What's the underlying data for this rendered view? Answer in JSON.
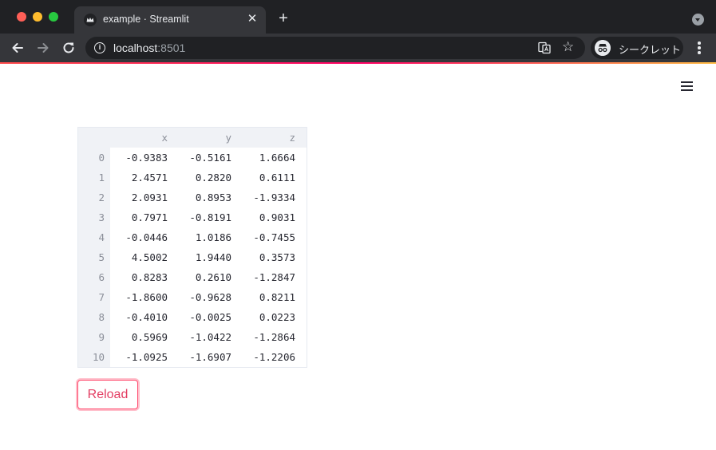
{
  "browser": {
    "tab_title": "example · Streamlit",
    "tab_close": "✕",
    "new_tab": "+",
    "url_host": "localhost",
    "url_port": ":8501",
    "incognito_label": "シークレット",
    "icons": [
      "back-arrow-icon",
      "forward-arrow-icon",
      "reload-icon",
      "info-icon",
      "translate-icon",
      "star-icon",
      "incognito-icon",
      "kebab-menu-icon",
      "tab-search-icon",
      "streamlit-crown-icon"
    ]
  },
  "app": {
    "menu_icon": "hamburger-icon",
    "accent_colors": [
      "#ff4b4b",
      "#ffbd45"
    ]
  },
  "dataframe": {
    "columns": [
      "x",
      "y",
      "z"
    ],
    "rows": [
      {
        "index": "0",
        "x": "-0.9383",
        "y": "-0.5161",
        "z": "1.6664"
      },
      {
        "index": "1",
        "x": "2.4571",
        "y": "0.2820",
        "z": "0.6111"
      },
      {
        "index": "2",
        "x": "2.0931",
        "y": "0.8953",
        "z": "-1.9334"
      },
      {
        "index": "3",
        "x": "0.7971",
        "y": "-0.8191",
        "z": "0.9031"
      },
      {
        "index": "4",
        "x": "-0.0446",
        "y": "1.0186",
        "z": "-0.7455"
      },
      {
        "index": "5",
        "x": "4.5002",
        "y": "1.9440",
        "z": "0.3573"
      },
      {
        "index": "6",
        "x": "0.8283",
        "y": "0.2610",
        "z": "-1.2847"
      },
      {
        "index": "7",
        "x": "-1.8600",
        "y": "-0.9628",
        "z": "0.8211"
      },
      {
        "index": "8",
        "x": "-0.4010",
        "y": "-0.0025",
        "z": "0.0223"
      },
      {
        "index": "9",
        "x": "0.5969",
        "y": "-1.0422",
        "z": "-1.2864"
      },
      {
        "index": "10",
        "x": "-1.0925",
        "y": "-1.6907",
        "z": "-1.2206"
      }
    ]
  },
  "reload_button": {
    "label": "Reload",
    "color": "#ff4b6e"
  }
}
